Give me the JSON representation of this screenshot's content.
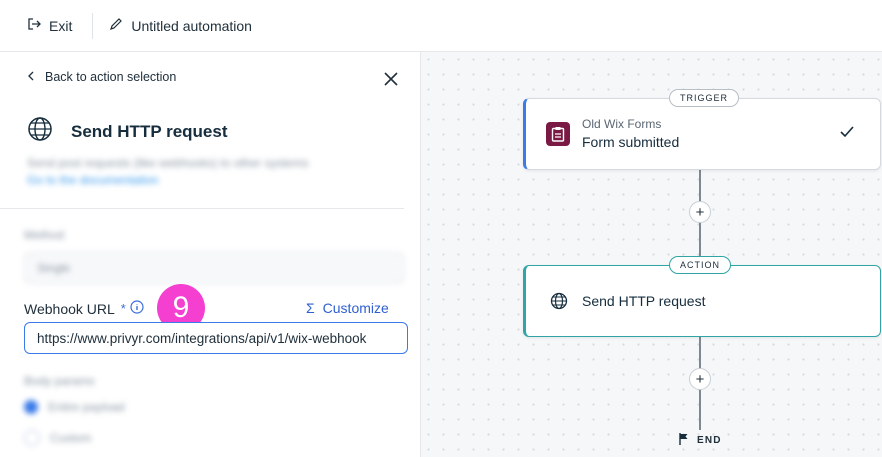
{
  "topbar": {
    "exit_label": "Exit",
    "automation_title": "Untitled automation"
  },
  "panel": {
    "back_label": "Back to action selection",
    "title": "Send HTTP request",
    "description": "Send post requests (like webhooks) to other systems",
    "description_link": "Go to the documentation",
    "method_label": "Method",
    "method_value": "Single",
    "webhook_url_label": "Webhook URL",
    "required_mark": "*",
    "step_badge": "9",
    "customize_label": "Customize",
    "customize_symbol": "Σ",
    "webhook_url_value": "https://www.privyr.com/integrations/api/v1/wix-webhook",
    "body_label": "Body params",
    "radio_options": [
      "Entire payload",
      "Custom"
    ]
  },
  "canvas": {
    "trigger_tag": "TRIGGER",
    "trigger_app": "Old Wix Forms",
    "trigger_event": "Form submitted",
    "action_tag": "ACTION",
    "action_title": "Send HTTP request",
    "plus_symbol": "+",
    "end_label": "END"
  },
  "colors": {
    "accent_blue": "#3b7be8",
    "action_teal": "#2fa5a5",
    "badge_pink": "#f53fd0",
    "forms_icon": "#7a1a44"
  }
}
